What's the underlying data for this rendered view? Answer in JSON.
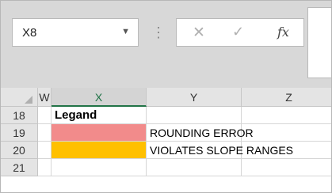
{
  "name_box": {
    "value": "X8",
    "dropdown_icon": "chevron-down-icon"
  },
  "formula_bar": {
    "cancel_icon": "cancel-x-icon",
    "enter_icon": "checkmark-icon",
    "fx_label": "fx",
    "value": ""
  },
  "columns": [
    {
      "label": "W"
    },
    {
      "label": "X",
      "selected": true
    },
    {
      "label": "Y"
    },
    {
      "label": "Z"
    }
  ],
  "rows": [
    {
      "number": "18",
      "cells": {
        "X": "Legand",
        "Y": ""
      }
    },
    {
      "number": "19",
      "cells": {
        "X": "",
        "Y": "ROUNDING ERROR"
      }
    },
    {
      "number": "20",
      "cells": {
        "X": "",
        "Y": "VIOLATES SLOPE RANGES"
      }
    },
    {
      "number": "21",
      "cells": {
        "X": "",
        "Y": ""
      }
    }
  ],
  "colors": {
    "rounding_error": "#f28b8b",
    "slope_ranges": "#ffc000",
    "selected_col_accent": "#217346"
  }
}
